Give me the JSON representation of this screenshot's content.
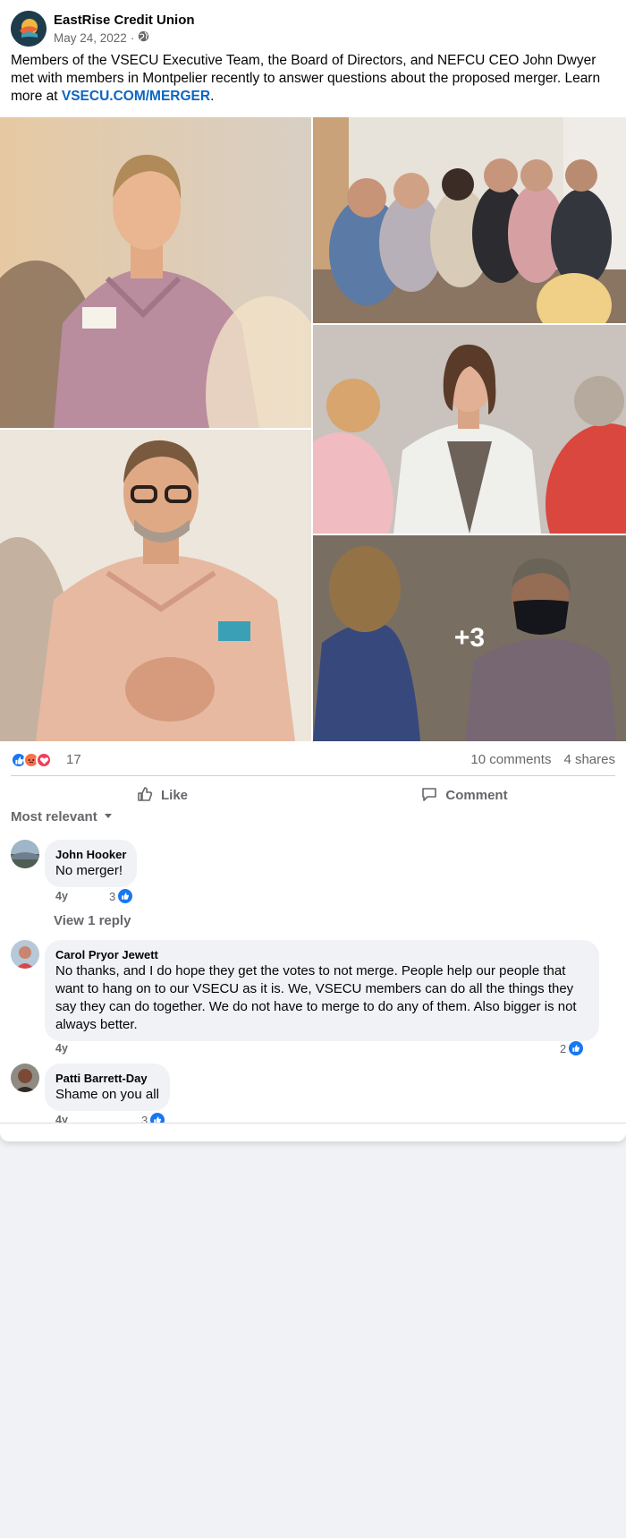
{
  "post": {
    "page_name": "EastRise Credit Union",
    "date": "May 24, 2022",
    "separator": "·",
    "privacy_icon": "globe-icon",
    "text": "Members of the VSECU Executive Team, the Board of Directors, and NEFCU CEO John Dwyer met with members in Montpelier recently to answer questions about the proposed merger. Learn more at ",
    "link_text": "VSECU.COM/MERGER",
    "text_end": "."
  },
  "photos": {
    "more_count": "+3"
  },
  "stats": {
    "reaction_icons": [
      "like-icon",
      "angry-icon",
      "love-icon"
    ],
    "reaction_count": "17",
    "comments": "10 comments",
    "shares": "4 shares"
  },
  "actions": {
    "like_label": "Like",
    "comment_label": "Comment"
  },
  "sort": {
    "label": "Most relevant"
  },
  "comments": [
    {
      "name": "John Hooker",
      "text": "No merger!",
      "time": "4y",
      "likes": "3",
      "reply": "View 1 reply"
    },
    {
      "name": "Carol Pryor Jewett",
      "text": "No thanks, and I do hope they get the votes to not merge. People help our people that want to hang on to our VSECU as it is. We, VSECU members can do all the things they say they can do together. We do not have to merge to do any of them. Also bigger is not always better.",
      "time": "4y",
      "likes": "2"
    },
    {
      "name": "Patti Barrett-Day",
      "text": "Shame on you all",
      "time": "4y",
      "likes": "3"
    }
  ],
  "colors": {
    "link": "#0a66c2",
    "like_blue": "#1877f2",
    "angry_orange": "#f7714c",
    "love_red": "#f33e58",
    "muted_text": "#65676b"
  }
}
